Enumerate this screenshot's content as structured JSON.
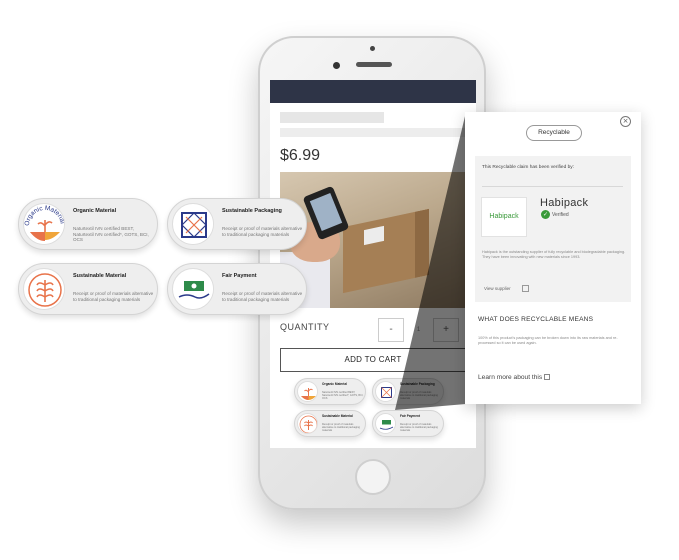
{
  "product": {
    "price": "$6.99",
    "quantity_label": "QUANTITY",
    "minus_label": "-",
    "plus_label": "+",
    "quantity_value": "1",
    "add_to_cart_label": "ADD TO CART"
  },
  "badges": [
    {
      "title": "Organic Material",
      "description": "Naturtextil IVN certified BEST, Naturtextil IVN certified*, GOTS, BCI, OCS",
      "icon": "organic-material-icon",
      "arc_text": "Organic Material",
      "color": "#e8734a"
    },
    {
      "title": "Sustainable Packaging",
      "description": "Receipt or proof of materials alternative to traditional packaging materials",
      "icon": "sustainable-packaging-icon",
      "color": "#2b3a8a"
    },
    {
      "title": "Sustainable Material",
      "description": "Receipt or proof of materials alternative to traditional packaging materials",
      "icon": "sustainable-material-icon",
      "color": "#e8734a"
    },
    {
      "title": "Fair Payment",
      "description": "Receipt or proof of materials alternative to traditional packaging materials",
      "icon": "fair-payment-icon",
      "color": "#2e8b4a"
    }
  ],
  "panel": {
    "pill_label": "Recyclable",
    "close_glyph": "×",
    "verify_heading": "This Recyclable claim has been verified by:",
    "supplier_name": "Habipack",
    "supplier_logo_text": "Habipack",
    "verified_label": "Verified",
    "supplier_description": "Habipack is the outstanding supplier of fully recyclable and biodegradable packaging. They have been innovating with new materials since 1993.",
    "view_supplier_label": "View supplier",
    "what_heading": "WHAT DOES RECYCLABLE MEANS",
    "what_description": "100% of this product's packaging can be broken down into its raw materials and re-processed so it can be used again.",
    "learn_more_label": "Learn more about this"
  },
  "colors": {
    "header_bar": "#2e3447",
    "verified_green": "#3a9a3a",
    "accent_orange": "#e8734a",
    "accent_blue": "#2b3a8a"
  }
}
